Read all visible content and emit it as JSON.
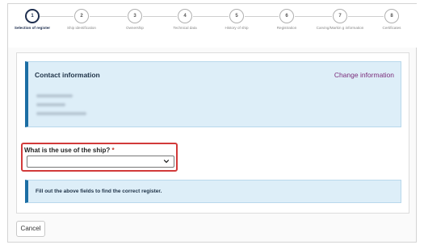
{
  "stepper": {
    "steps": [
      {
        "number": "1",
        "label": "Selection of register",
        "active": true
      },
      {
        "number": "2",
        "label": "Ship identification",
        "active": false
      },
      {
        "number": "3",
        "label": "Ownership",
        "active": false
      },
      {
        "number": "4",
        "label": "Technical data",
        "active": false
      },
      {
        "number": "5",
        "label": "History of ship",
        "active": false
      },
      {
        "number": "6",
        "label": "Registration",
        "active": false
      },
      {
        "number": "7",
        "label": "Carving/Markin g information",
        "active": false
      },
      {
        "number": "8",
        "label": "Certificates",
        "active": false
      }
    ]
  },
  "contact": {
    "title": "Contact information",
    "change_link": "Change information"
  },
  "form": {
    "question": "What is the use of the ship?",
    "required_mark": "*",
    "select_value": "",
    "chevron_icon": "chevron-down"
  },
  "info_box": {
    "text": "Fill out the above fields to find the correct register."
  },
  "footer": {
    "cancel_label": "Cancel"
  },
  "colors": {
    "accent": "#1c6ea4",
    "panel_bg": "#ddeef8",
    "link": "#7a2b7a",
    "error_outline": "#d23a3a",
    "active_step": "#1f2f4f"
  }
}
